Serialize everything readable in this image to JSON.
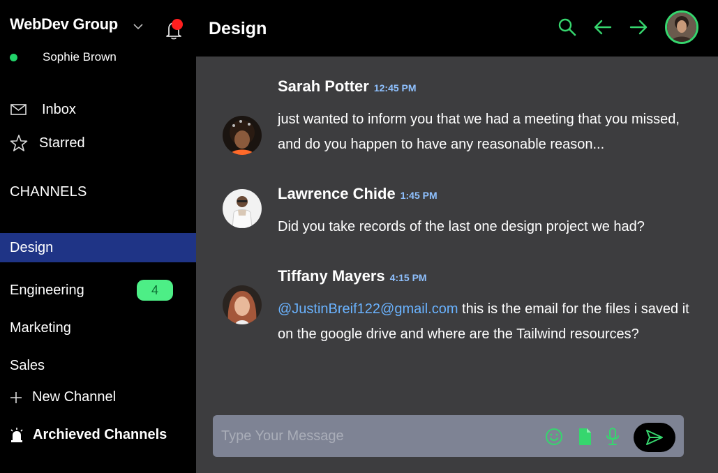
{
  "team": {
    "name": "WebDev Group"
  },
  "user": {
    "name": "Sophie Brown",
    "status_color": "#22d36a"
  },
  "nav": [
    {
      "label": "Inbox",
      "icon": "mail-icon"
    },
    {
      "label": "Starred",
      "icon": "star-icon"
    }
  ],
  "channels": {
    "heading": "CHANNELS",
    "items": [
      {
        "label": "Design",
        "active": true
      },
      {
        "label": "Engineering",
        "badge": "4"
      },
      {
        "label": "Marketing"
      },
      {
        "label": "Sales"
      }
    ],
    "new_channel": "New Channel",
    "archived": "Archieved Channels"
  },
  "header": {
    "title": "Design"
  },
  "messages": [
    {
      "name": "Sarah Potter",
      "time": "12:45 PM",
      "text": "just wanted to inform you that we had a meeting that you missed, and do you happen to have any reasonable reason..."
    },
    {
      "name": "Lawrence Chide",
      "time": "1:45 PM",
      "text": "Did you take records of the last one design project we had?"
    },
    {
      "name": "Tiffany Mayers",
      "time": "4:15 PM",
      "mention": "@JustinBreif122@gmail.com",
      "text": " this is the email for the files i saved it on the google drive and where are the Tailwind resources?"
    }
  ],
  "composer": {
    "placeholder": "Type Your Message"
  },
  "colors": {
    "accent_green": "#36d66e",
    "active_channel": "#1f3486",
    "chat_bg": "#3d3d3f",
    "time_color": "#8fc1ff",
    "mention_color": "#6ab3ff",
    "notification_dot": "#ff1f1f"
  }
}
